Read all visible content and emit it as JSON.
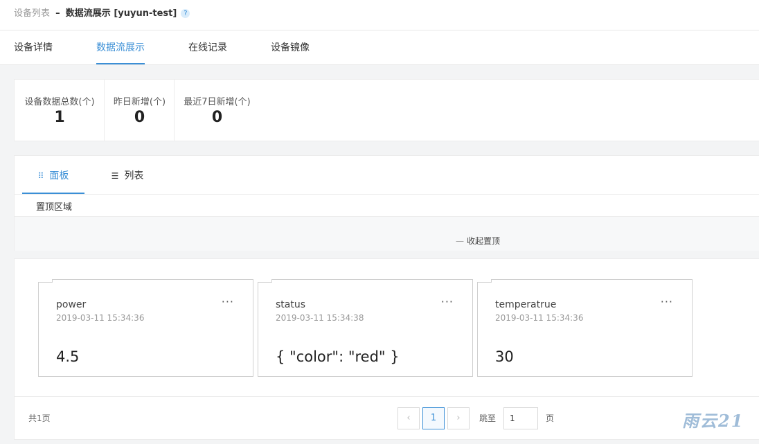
{
  "header": {
    "breadcrumb_parent": "设备列表",
    "breadcrumb_separator": "–",
    "breadcrumb_current": "数据流展示 [yuyun-test]",
    "help_icon_glyph": "?"
  },
  "main_tabs": [
    {
      "label": "设备详情",
      "active": false
    },
    {
      "label": "数据流展示",
      "active": true
    },
    {
      "label": "在线记录",
      "active": false
    },
    {
      "label": "设备镜像",
      "active": false
    }
  ],
  "stats": [
    {
      "label": "设备数据总数(个)",
      "value": "1"
    },
    {
      "label": "昨日新增(个)",
      "value": "0"
    },
    {
      "label": "最近7日新增(个)",
      "value": "0"
    }
  ],
  "view_tabs": [
    {
      "label": "面板",
      "icon": "grid-icon",
      "glyph": "⠿",
      "active": true
    },
    {
      "label": "列表",
      "icon": "list-icon",
      "glyph": "☰",
      "active": false
    }
  ],
  "pinned": {
    "title": "置顶区域",
    "collapse_label": "收起置顶",
    "collapse_glyph": "—"
  },
  "datapoints": [
    {
      "name": "power",
      "time": "2019-03-11 15:34:36",
      "value": "4.5"
    },
    {
      "name": "status",
      "time": "2019-03-11 15:34:38",
      "value": "{ \"color\": \"red\" }"
    },
    {
      "name": "temperatrue",
      "time": "2019-03-11 15:34:36",
      "value": "30"
    }
  ],
  "menu_glyph": "···",
  "pagination": {
    "total_label": "共1页",
    "prev_glyph": "‹",
    "next_glyph": "›",
    "current_page": "1",
    "jump_label": "跳至",
    "jump_value": "1",
    "page_unit": "页"
  },
  "watermark": "雨云21",
  "colors": {
    "accent": "#3b8fd6",
    "background": "#f3f4f5",
    "card": "#ffffff"
  }
}
